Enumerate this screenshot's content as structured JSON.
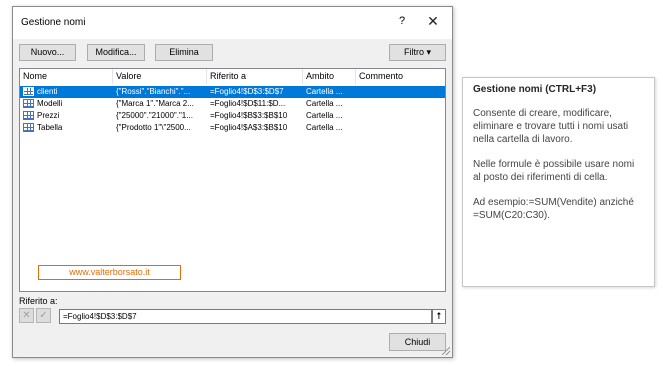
{
  "dialog": {
    "title": "Gestione nomi",
    "help": "?",
    "close": "✕",
    "buttons": {
      "new": "Nuovo...",
      "edit": "Modifica...",
      "delete": "Elimina",
      "filter": "Filtro ▾"
    },
    "columns": [
      "Nome",
      "Valore",
      "Riferito a",
      "Ambito",
      "Commento"
    ],
    "rows": [
      {
        "name": "clienti",
        "value": "{\"Rossi\".\"Bianchi\".\"...",
        "ref": "=Foglio4!$D$3:$D$7",
        "scope": "Cartella ...",
        "comment": ""
      },
      {
        "name": "Modelli",
        "value": "{\"Marca 1\".\"Marca 2...",
        "ref": "=Foglio4!$D$11:$D...",
        "scope": "Cartella ...",
        "comment": ""
      },
      {
        "name": "Prezzi",
        "value": "{\"25000\".\"21000\".\"1...",
        "ref": "=Foglio4!$B$3:$B$10",
        "scope": "Cartella ...",
        "comment": ""
      },
      {
        "name": "Tabella",
        "value": "{\"Prodotto 1\"\\\"2500...",
        "ref": "=Foglio4!$A$3:$B$10",
        "scope": "Cartella ...",
        "comment": ""
      }
    ],
    "watermark": "www.valterborsato.it",
    "refers_to_label": "Riferito a:",
    "refers_to_value": "=Foglio4!$D$3:$D$7",
    "close_button": "Chiudi"
  },
  "tooltip": {
    "title": "Gestione nomi (CTRL+F3)",
    "p1": "Consente di creare, modificare, eliminare e trovare tutti i nomi usati nella cartella di lavoro.",
    "p2": "Nelle formule è possibile usare nomi al posto dei riferimenti di cella.",
    "p3": "Ad esempio:=SUM(Vendite) anziché =SUM(C20:C30)."
  },
  "colors": {
    "selection": "#0078d7",
    "icon": "#4472c4",
    "watermark": "#e36c09"
  }
}
